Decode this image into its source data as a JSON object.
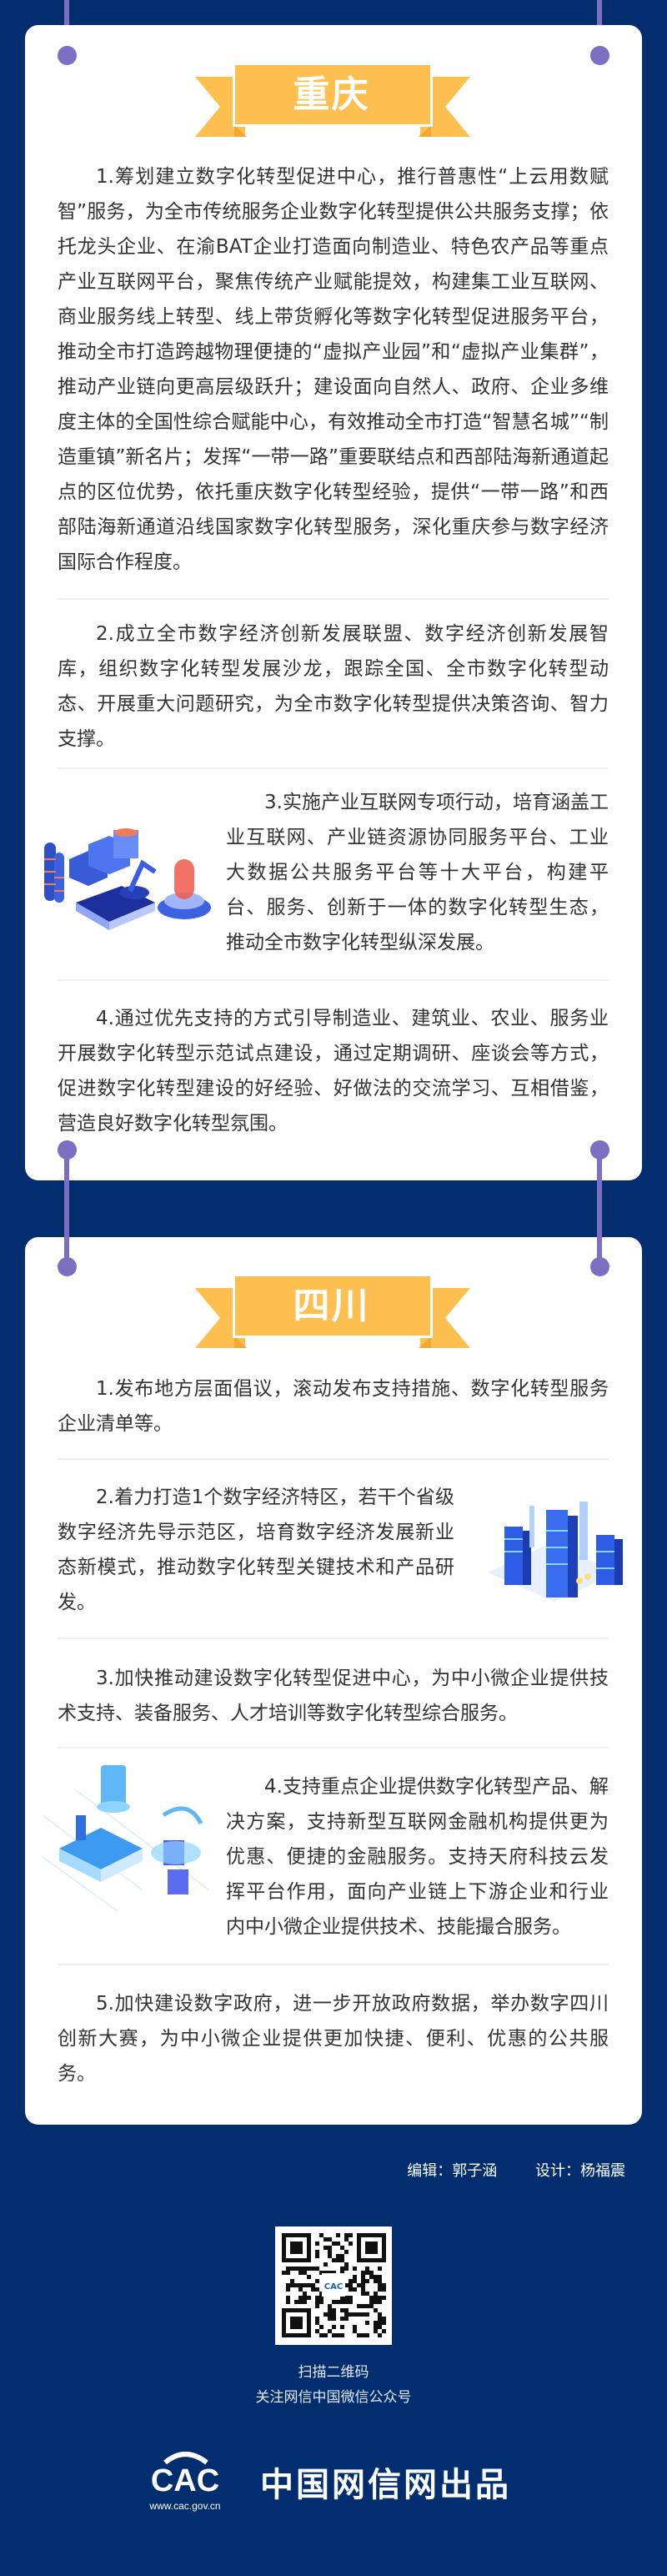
{
  "colors": {
    "background": "#022e70",
    "card": "#ffffff",
    "ribbon": "#fdbf50",
    "pin": "#7c6fc2",
    "text": "#333333"
  },
  "chongqing": {
    "title": "重庆",
    "items": [
      "1.筹划建立数字化转型促进中心，推行普惠性“上云用数赋智”服务，为全市传统服务企业数字化转型提供公共服务支撑；依托龙头企业、在渝BAT企业打造面向制造业、特色农产品等重点产业互联网平台，聚焦传统产业赋能提效，构建集工业互联网、商业服务线上转型、线上带货孵化等数字化转型促进服务平台，推动全市打造跨越物理便捷的“虚拟产业园”和“虚拟产业集群”，推动产业链向更高层级跃升；建设面向自然人、政府、企业多维度主体的全国性综合赋能中心，有效推动全市打造“智慧名城”“制造重镇”新名片；发挥“一带一路”重要联结点和西部陆海新通道起点的区位优势，依托重庆数字化转型经验，提供“一带一路”和西部陆海新通道沿线国家数字化转型服务，深化重庆参与数字经济国际合作程度。",
      "2.成立全市数字经济创新发展联盟、数字经济创新发展智库，组织数字化转型发展沙龙，跟踪全国、全市数字化转型动态、开展重大问题研究，为全市数字化转型提供决策咨询、智力支撑。",
      "3.实施产业互联网专项行动，培育涵盖工业互联网、产业链资源协同服务平台、工业大数据公共服务平台等十大平台，构建平台、服务、创新于一体的数字化转型生态，推动全市数字化转型纵深发展。",
      "4.通过优先支持的方式引导制造业、建筑业、农业、服务业开展数字化转型示范试点建设，通过定期调研、座谈会等方式，促进数字化转型建设的好经验、好做法的交流学习、互相借鉴，营造良好数字化转型氛围。"
    ]
  },
  "sichuan": {
    "title": "四川",
    "items": [
      "1.发布地方层面倡议，滚动发布支持措施、数字化转型服务企业清单等。",
      "2.着力打造1个数字经济特区，若干个省级数字经济先导示范区，培育数字经济发展新业态新模式，推动数字化转型关键技术和产品研发。",
      "3.加快推动建设数字化转型促进中心，为中小微企业提供技术支持、装备服务、人才培训等数字化转型综合服务。",
      "4.支持重点企业提供数字化转型产品、解决方案，支持新型互联网金融机构提供更为优惠、便捷的金融服务。支持天府科技云发挥平台作用，面向产业链上下游企业和行业内中小微企业提供技术、技能撮合服务。",
      "5.加快建设数字政府，进一步开放政府数据，举办数字四川创新大赛，为中小微企业提供更加快捷、便利、优惠的公共服务。"
    ]
  },
  "footer": {
    "editor": "编辑：郭子涵",
    "designer": "设计：杨福震",
    "scan_line1": "扫描二维码",
    "scan_line2": "关注网信中国微信公众号",
    "logo_text": "CAC",
    "logo_url": "www.cac.gov.cn",
    "brand": "中国网信网出品"
  }
}
